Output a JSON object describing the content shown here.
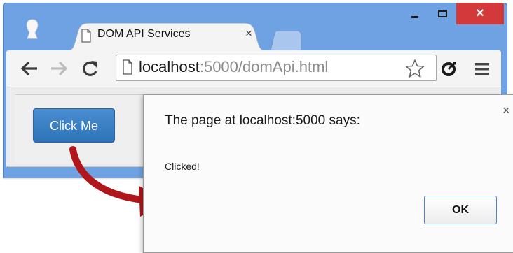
{
  "browser": {
    "tab": {
      "title": "DOM API Services",
      "close_glyph": "×"
    },
    "window_controls": {
      "close_glyph": "×"
    },
    "address": {
      "host": "localhost",
      "path": ":5000/domApi.html"
    }
  },
  "page": {
    "button_label": "Click Me"
  },
  "dialog": {
    "title": "The page at localhost:5000 says:",
    "message": "Clicked!",
    "ok_label": "OK",
    "close_glyph": "×"
  },
  "colors": {
    "frame": "#6fa2e3",
    "close_button": "#d3393a",
    "primary_button": "#337ab7",
    "arrow": "#b0161a"
  },
  "icons": [
    "user-avatar-icon",
    "document-icon",
    "back-arrow-icon",
    "forward-arrow-icon",
    "reload-icon",
    "star-icon",
    "extension-icon",
    "menu-icon",
    "curved-arrow-icon"
  ]
}
